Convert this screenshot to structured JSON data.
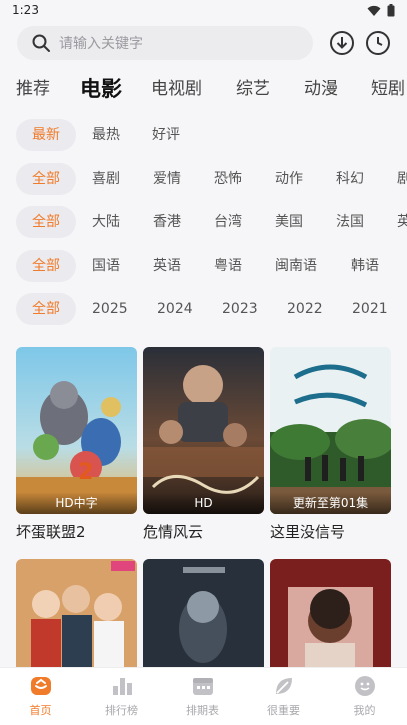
{
  "status_bar": {
    "time": "1:23"
  },
  "search": {
    "placeholder": "请输入关键字"
  },
  "tabs": [
    {
      "label": "推荐",
      "active": false
    },
    {
      "label": "电影",
      "active": true
    },
    {
      "label": "电视剧",
      "active": false
    },
    {
      "label": "综艺",
      "active": false
    },
    {
      "label": "动漫",
      "active": false
    },
    {
      "label": "短剧",
      "active": false
    }
  ],
  "filters": {
    "sort": [
      "最新",
      "最热",
      "好评"
    ],
    "genre": [
      "全部",
      "喜剧",
      "爱情",
      "恐怖",
      "动作",
      "科幻",
      "剧情"
    ],
    "region": [
      "全部",
      "大陆",
      "香港",
      "台湾",
      "美国",
      "法国",
      "英国"
    ],
    "language": [
      "全部",
      "国语",
      "英语",
      "粤语",
      "闽南语",
      "韩语"
    ],
    "year": [
      "全部",
      "2025",
      "2024",
      "2023",
      "2022",
      "2021"
    ]
  },
  "movies": [
    {
      "title": "坏蛋联盟2",
      "badge": "HD中字"
    },
    {
      "title": "危情风云",
      "badge": "HD"
    },
    {
      "title": "这里没信号",
      "badge": "更新至第01集"
    },
    {
      "title": "",
      "badge": ""
    },
    {
      "title": "",
      "badge": ""
    },
    {
      "title": "",
      "badge": ""
    }
  ],
  "nav": [
    {
      "label": "首页",
      "icon": "home-icon",
      "active": true
    },
    {
      "label": "排行榜",
      "icon": "ranking-icon",
      "active": false
    },
    {
      "label": "排期表",
      "icon": "calendar-icon",
      "active": false
    },
    {
      "label": "很重要",
      "icon": "leaf-icon",
      "active": false
    },
    {
      "label": "我的",
      "icon": "profile-icon",
      "active": false
    }
  ],
  "colors": {
    "accent": "#f07b2a",
    "background": "#f6f6f8",
    "chip_bg": "#ebebef"
  }
}
